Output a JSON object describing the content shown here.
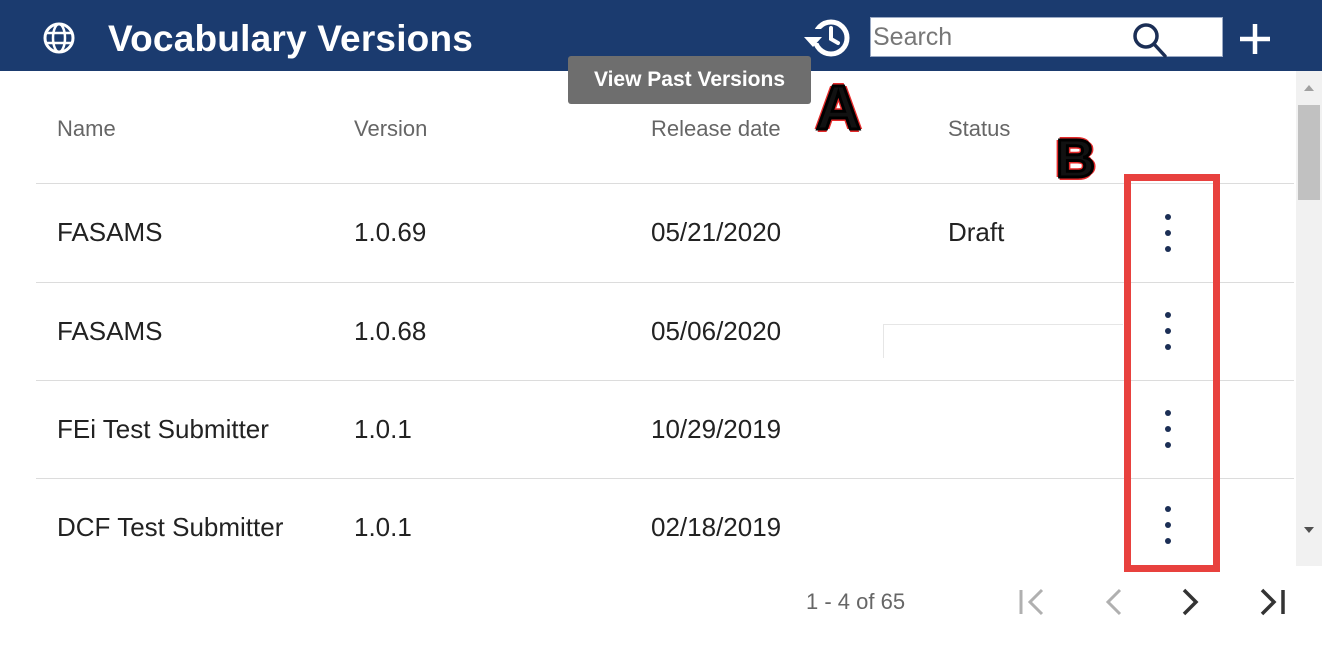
{
  "header": {
    "title": "Vocabulary Versions",
    "icon": "globe-icon",
    "history_icon": "history-icon",
    "search_placeholder": "Search",
    "search_value": "",
    "add_icon": "plus-icon",
    "background": "#1b3b6f"
  },
  "tooltip": {
    "text": "View Past Versions"
  },
  "annotations": {
    "a": "A",
    "b": "B",
    "highlight_color": "#e8413e"
  },
  "table": {
    "columns": [
      "Name",
      "Version",
      "Release date",
      "Status"
    ],
    "rows": [
      {
        "name": "FASAMS",
        "version": "1.0.69",
        "release_date": "05/21/2020",
        "status": "Draft"
      },
      {
        "name": "FASAMS",
        "version": "1.0.68",
        "release_date": "05/06/2020",
        "status": ""
      },
      {
        "name": "FEi Test Submitter",
        "version": "1.0.1",
        "release_date": "10/29/2019",
        "status": ""
      },
      {
        "name": "DCF Test Submitter",
        "version": "1.0.1",
        "release_date": "02/18/2019",
        "status": ""
      }
    ],
    "row_action_icon": "more-vertical-icon"
  },
  "pagination": {
    "range": "1 - 4 of 65",
    "first_icon": "first-page-icon",
    "prev_icon": "chevron-left-icon",
    "next_icon": "chevron-right-icon",
    "last_icon": "last-page-icon"
  }
}
